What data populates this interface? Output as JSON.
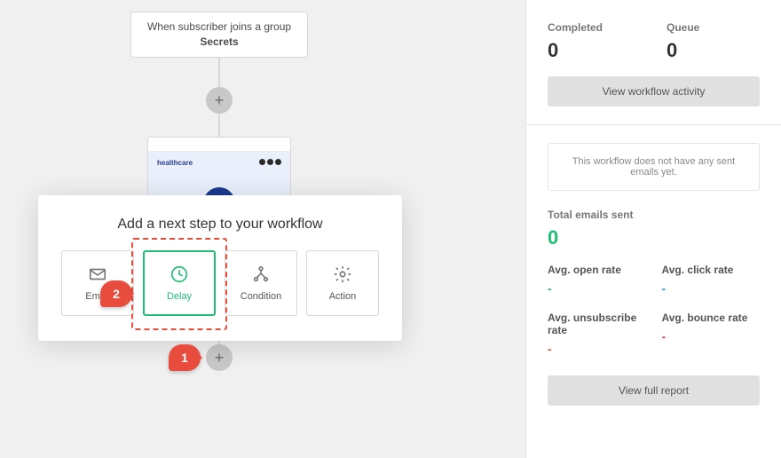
{
  "trigger": {
    "line1": "When subscriber joins a group",
    "group_name": "Secrets"
  },
  "email_preview": {
    "brand": "healthcare"
  },
  "popup": {
    "title": "Add a next step to your workflow",
    "options": {
      "email": "Email",
      "delay": "Delay",
      "condition": "Condition",
      "action": "Action"
    }
  },
  "annotations": {
    "marker1": "1",
    "marker2": "2"
  },
  "sidebar": {
    "completed_label": "Completed",
    "completed_value": "0",
    "queue_label": "Queue",
    "queue_value": "0",
    "view_activity": "View workflow activity",
    "notice": "This workflow does not have any sent emails yet.",
    "total_sent_label": "Total emails sent",
    "total_sent_value": "0",
    "open_rate_label": "Avg. open rate",
    "open_rate_value": "-",
    "click_rate_label": "Avg. click rate",
    "click_rate_value": "-",
    "unsub_rate_label": "Avg. unsubscribe rate",
    "unsub_rate_value": "-",
    "bounce_rate_label": "Avg. bounce rate",
    "bounce_rate_value": "-",
    "view_report": "View full report"
  }
}
